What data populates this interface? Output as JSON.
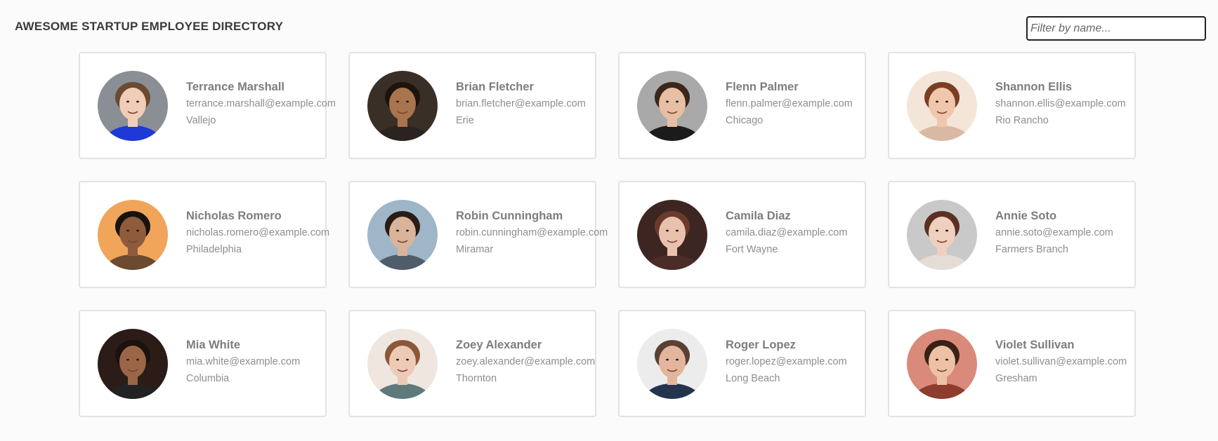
{
  "header": {
    "title": "AWESOME STARTUP EMPLOYEE DIRECTORY",
    "search_placeholder": "Filter by name..."
  },
  "employees": [
    {
      "name": "Terrance Marshall",
      "email": "terrance.marshall@example.com",
      "city": "Vallejo",
      "bg": "#8a8f96",
      "skin": "#f0cdb7",
      "hair": "#6b4a33",
      "shirt": "#1d3ad6"
    },
    {
      "name": "Brian Fletcher",
      "email": "brian.fletcher@example.com",
      "city": "Erie",
      "bg": "#3a2f26",
      "skin": "#a8754f",
      "hair": "#1e140e",
      "shirt": "#2b2320"
    },
    {
      "name": "Flenn Palmer",
      "email": "flenn.palmer@example.com",
      "city": "Chicago",
      "bg": "#a9a9a9",
      "skin": "#e7bfa4",
      "hair": "#3a2718",
      "shirt": "#1b1b1b"
    },
    {
      "name": "Shannon Ellis",
      "email": "shannon.ellis@example.com",
      "city": "Rio Rancho",
      "bg": "#f3e6d8",
      "skin": "#f0c6ad",
      "hair": "#7a3f22",
      "shirt": "#d9b9a3"
    },
    {
      "name": "Nicholas Romero",
      "email": "nicholas.romero@example.com",
      "city": "Philadelphia",
      "bg": "#f0a55a",
      "skin": "#8e5c3c",
      "hair": "#1a1210",
      "shirt": "#6b4a30"
    },
    {
      "name": "Robin Cunningham",
      "email": "robin.cunningham@example.com",
      "city": "Miramar",
      "bg": "#9fb6c8",
      "skin": "#d9b39a",
      "hair": "#2a1b14",
      "shirt": "#4f5d6a"
    },
    {
      "name": "Camila Diaz",
      "email": "camila.diaz@example.com",
      "city": "Fort Wayne",
      "bg": "#3d2622",
      "skin": "#e9c2ad",
      "hair": "#6a3a2c",
      "shirt": "#4a2c28"
    },
    {
      "name": "Annie Soto",
      "email": "annie.soto@example.com",
      "city": "Farmers Branch",
      "bg": "#c9c9c9",
      "skin": "#efd0bf",
      "hair": "#5b2f22",
      "shirt": "#e6dcd6"
    },
    {
      "name": "Mia White",
      "email": "mia.white@example.com",
      "city": "Columbia",
      "bg": "#2b1c17",
      "skin": "#9a6647",
      "hair": "#1b110d",
      "shirt": "#222222"
    },
    {
      "name": "Zoey Alexander",
      "email": "zoey.alexander@example.com",
      "city": "Thornton",
      "bg": "#efe6df",
      "skin": "#eccab6",
      "hair": "#8a5738",
      "shirt": "#5e7a7d"
    },
    {
      "name": "Roger Lopez",
      "email": "roger.lopez@example.com",
      "city": "Long Beach",
      "bg": "#ececec",
      "skin": "#e3b59c",
      "hair": "#5a4032",
      "shirt": "#24344f"
    },
    {
      "name": "Violet Sullivan",
      "email": "violet.sullivan@example.com",
      "city": "Gresham",
      "bg": "#d98a7a",
      "skin": "#edc1a5",
      "hair": "#3a2016",
      "shirt": "#8d3c2e"
    }
  ]
}
